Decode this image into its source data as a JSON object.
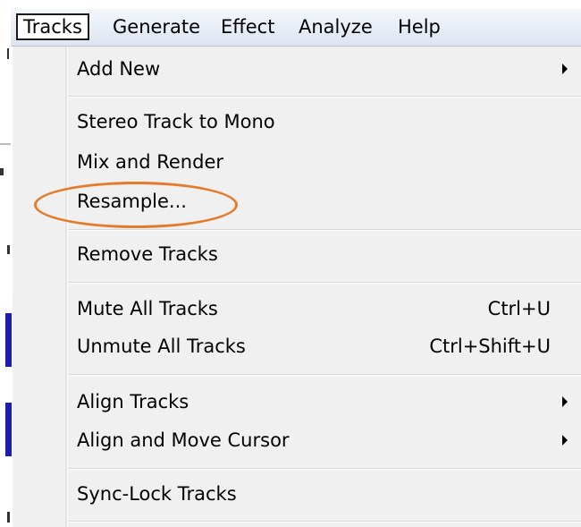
{
  "menubar": {
    "items": [
      {
        "label": "Tracks",
        "active": true
      },
      {
        "label": "Generate"
      },
      {
        "label": "Effect"
      },
      {
        "label": "Analyze"
      },
      {
        "label": "Help"
      }
    ]
  },
  "tracks_menu": {
    "add_new": "Add New",
    "stereo_to_mono": "Stereo Track to Mono",
    "mix_and_render": "Mix and Render",
    "resample": "Resample...",
    "remove_tracks": "Remove Tracks",
    "mute_all": "Mute All Tracks",
    "mute_all_shortcut": "Ctrl+U",
    "unmute_all": "Unmute All Tracks",
    "unmute_all_shortcut": "Ctrl+Shift+U",
    "align_tracks": "Align Tracks",
    "align_move_cursor": "Align and Move Cursor",
    "sync_lock": "Sync-Lock Tracks"
  },
  "colors": {
    "highlight_ellipse": "#e37b2b",
    "menu_background": "#f0f0f0"
  }
}
